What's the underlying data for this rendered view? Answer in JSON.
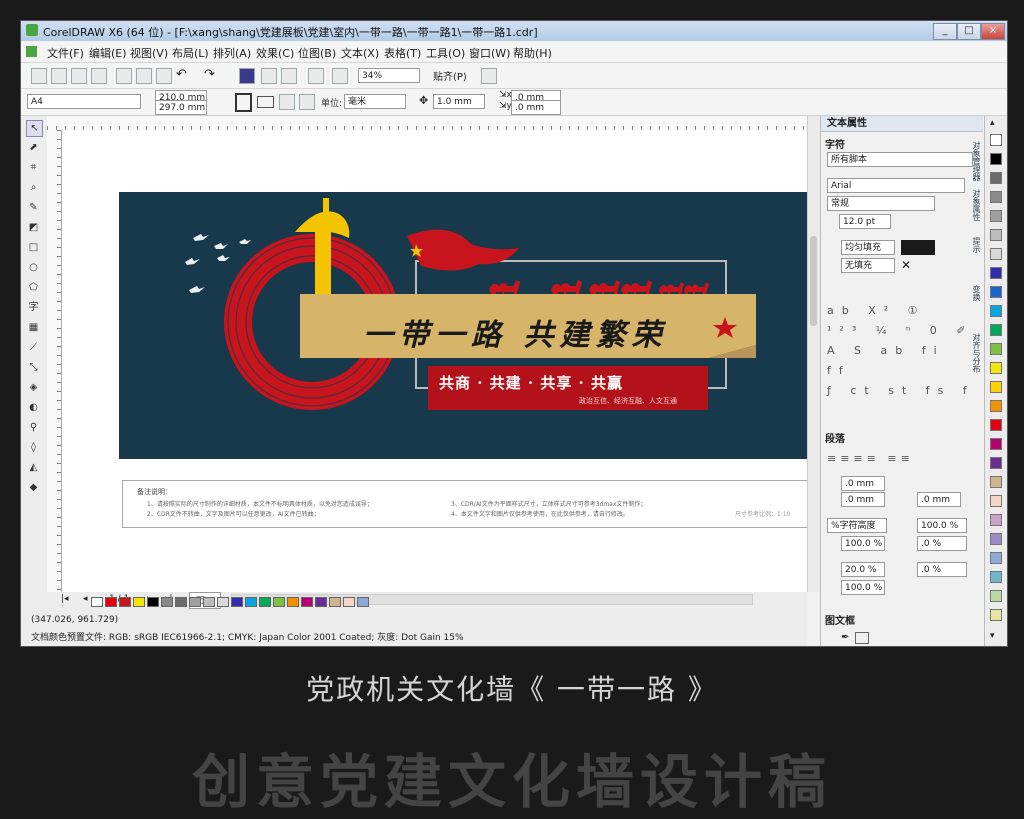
{
  "window": {
    "title": "CorelDRAW X6 (64 位) - [F:\\xang\\shang\\党建展板\\党建\\室内\\一带一路\\一带一路1\\一带一路1.cdr]",
    "controls": [
      "_",
      "□",
      "×"
    ]
  },
  "menu": [
    "文件(F)",
    "编辑(E)",
    "视图(V)",
    "布局(L)",
    "排列(A)",
    "效果(C)",
    "位图(B)",
    "文本(X)",
    "表格(T)",
    "工具(O)",
    "窗口(W)",
    "帮助(H)"
  ],
  "toolbar": {
    "zoom": "34%",
    "snap": "贴齐(P)"
  },
  "property_bar": {
    "page_size": "A4",
    "width": "210.0 mm",
    "height": "297.0 mm",
    "units_label": "单位:",
    "units": "毫米",
    "nudge": "1.0 mm",
    "dup_x": ".0 mm",
    "dup_y": ".0 mm"
  },
  "design": {
    "title": "一带一路  共建繁荣",
    "slogan": "共商 · 共建 · 共享 · 共赢",
    "subtitle": "政治互信、经济互融、人文互通"
  },
  "notes": {
    "heading": "备注说明：",
    "lines": [
      "1、请按照实际的尺寸制作的详细材质，本文件不标明具体材质，以免对您造成误导；",
      "2、CDR文件不转曲，文字及图片可以任意更改，AI文件已转曲；",
      "3、CDR/AI文件为平面样式尺寸，立体样式尺寸可参考3dmax文件制作；",
      "4、本文件文字和图片仅供参考使用，在此仅供参考，请自行修改。",
      "尺寸参考比例：1:10"
    ]
  },
  "statusbar": {
    "page_nav": "1 / 1",
    "page_tab": "页 1",
    "coords": "(347.026, 961.729)",
    "color_profile": "文档颜色预置文件: RGB: sRGB IEC61966-2.1; CMYK: Japan Color 2001 Coated; 灰度: Dot Gain 15%"
  },
  "panel": {
    "title": "文本属性",
    "section_char": "字符",
    "script": "所有脚本",
    "font": "Arial",
    "style": "常规",
    "size": "12.0 pt",
    "fill": "均匀填充",
    "bg_fill": "无填充",
    "section_para": "段落",
    "indent1": ".0 mm",
    "indent2": ".0 mm",
    "indent3": ".0 mm",
    "line_spacing_mode": "%字符高度",
    "line_spacing": "100.0 %",
    "para_before": "100.0 %",
    "para_after": ".0 %",
    "char_spacing": "20.0 %",
    "word_spacing": ".0 %",
    "lang_spacing": "100.0 %",
    "section_frame": "图文框",
    "side_tabs": [
      "对象管理器",
      "对象属性",
      "提示",
      "变换",
      "对齐与分布"
    ]
  },
  "caption": "党政机关文化墙《 一带一路 》",
  "headline": "创意党建文化墙设计稿",
  "colors": {
    "design_bg": "#18384b",
    "red": "#c8141c",
    "gold": "#d6b46a",
    "yellow": "#f5c400"
  },
  "palette_colors": [
    "#ffffff",
    "#000000",
    "#6b6b6b",
    "#8a8a8a",
    "#a0a0a0",
    "#bdbdbd",
    "#d9d9d9",
    "#2e2ea8",
    "#1a63c8",
    "#0aa5e0",
    "#00a859",
    "#7bc143",
    "#f3e600",
    "#ffd200",
    "#f39200",
    "#e3000f",
    "#b5006f",
    "#6a2c91",
    "#d2b48c",
    "#f5d5c8",
    "#c9a3c9",
    "#9f8ac8",
    "#8fa9d6",
    "#6fb7c8",
    "#b8d8a8",
    "#e6e6a0"
  ],
  "bottom_swatches": [
    "#ffffff",
    "#e3000f",
    "#c8141c",
    "#f3e600",
    "#000000",
    "#8a8a8a",
    "#6b6b6b",
    "#a0a0a0",
    "#bdbdbd",
    "#d9d9d9",
    "#2e2ea8",
    "#0aa5e0",
    "#00a859",
    "#7bc143",
    "#f39200",
    "#b5006f",
    "#6a2c91",
    "#d2b48c",
    "#f5d5c8",
    "#8fa9d6"
  ]
}
